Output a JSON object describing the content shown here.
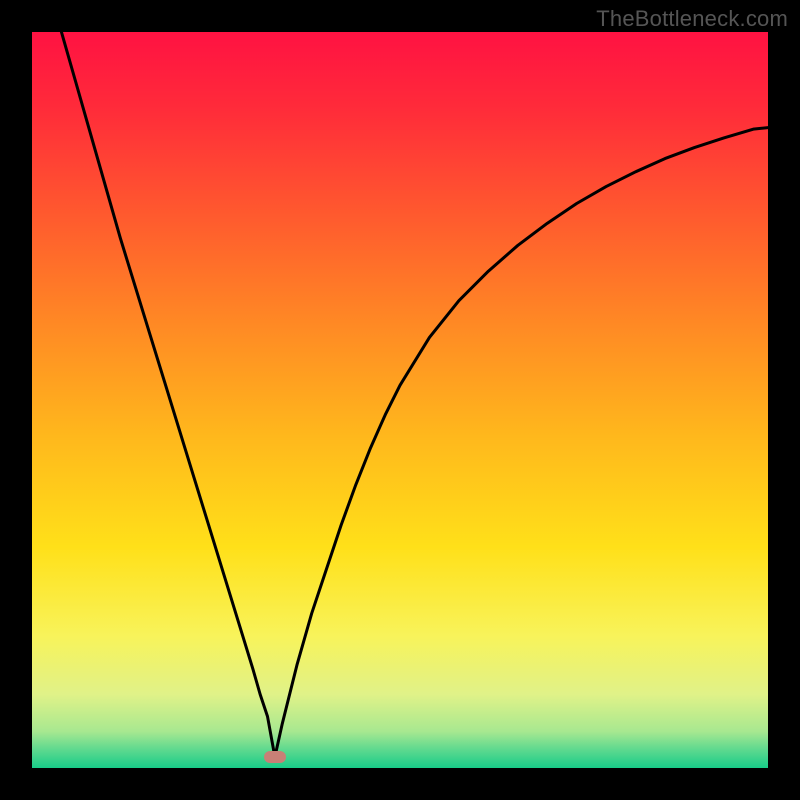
{
  "watermark": "TheBottleneck.com",
  "chart_data": {
    "type": "line",
    "title": "",
    "xlabel": "",
    "ylabel": "",
    "xlim": [
      0,
      100
    ],
    "ylim": [
      0,
      100
    ],
    "grid": false,
    "legend": false,
    "annotations": [],
    "marker": {
      "x": 33,
      "y": 1.5,
      "color": "#c88076"
    },
    "series": [
      {
        "name": "bottleneck-curve",
        "color": "#000000",
        "x": [
          4,
          6,
          8,
          10,
          12,
          14,
          16,
          18,
          20,
          22,
          24,
          26,
          28,
          30,
          31,
          32,
          33,
          34,
          35,
          36,
          38,
          40,
          42,
          44,
          46,
          48,
          50,
          54,
          58,
          62,
          66,
          70,
          74,
          78,
          82,
          86,
          90,
          94,
          98,
          100
        ],
        "y": [
          100,
          93,
          86,
          79,
          72,
          65.5,
          59,
          52.5,
          46,
          39.5,
          33,
          26.5,
          20,
          13.5,
          10,
          7,
          1.5,
          6,
          10,
          14,
          21,
          27,
          33,
          38.5,
          43.5,
          48,
          52,
          58.5,
          63.5,
          67.5,
          71,
          74,
          76.7,
          79,
          81,
          82.8,
          84.3,
          85.6,
          86.8,
          87
        ]
      }
    ],
    "background_gradient": {
      "type": "vertical",
      "stops": [
        {
          "pos": 0.0,
          "color": "#ff1242"
        },
        {
          "pos": 0.1,
          "color": "#ff2a3a"
        },
        {
          "pos": 0.25,
          "color": "#ff5a2e"
        },
        {
          "pos": 0.4,
          "color": "#ff8a24"
        },
        {
          "pos": 0.55,
          "color": "#ffb81c"
        },
        {
          "pos": 0.7,
          "color": "#ffe019"
        },
        {
          "pos": 0.82,
          "color": "#f8f35a"
        },
        {
          "pos": 0.9,
          "color": "#e0f288"
        },
        {
          "pos": 0.95,
          "color": "#a8e890"
        },
        {
          "pos": 0.975,
          "color": "#5ed98f"
        },
        {
          "pos": 1.0,
          "color": "#18cc88"
        }
      ]
    }
  }
}
